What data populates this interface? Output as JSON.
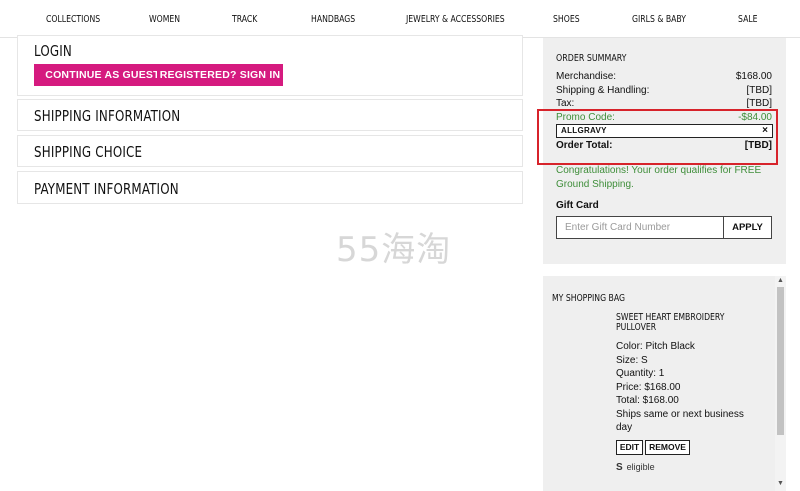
{
  "nav": {
    "items": [
      "COLLECTIONS",
      "WOMEN",
      "TRACK",
      "HANDBAGS",
      "JEWELRY & ACCESSORIES",
      "SHOES",
      "GIRLS & BABY",
      "SALE"
    ]
  },
  "checkout": {
    "login": {
      "title": "LOGIN",
      "guest_button": "CONTINUE AS GUEST",
      "signin_button": "REGISTERED? SIGN IN"
    },
    "shipping_info": "SHIPPING INFORMATION",
    "shipping_choice": "SHIPPING CHOICE",
    "payment_info": "PAYMENT INFORMATION"
  },
  "summary": {
    "title": "ORDER SUMMARY",
    "merchandise_label": "Merchandise:",
    "merchandise_value": "$168.00",
    "shipping_label": "Shipping & Handling:",
    "shipping_value": "[TBD]",
    "tax_label": "Tax:",
    "tax_value": "[TBD]",
    "promo_label": "Promo Code:",
    "promo_value": "-$84.00",
    "promo_code": "ALLGRAVY",
    "remove_glyph": "×",
    "total_label": "Order Total:",
    "total_value": "[TBD]",
    "congrats": "Congratulations! Your order qualifies for FREE Ground Shipping.",
    "gift_label": "Gift Card",
    "gift_placeholder": "Enter Gift Card Number",
    "apply_label": "APPLY"
  },
  "watermark": "55海淘",
  "bag": {
    "title": "MY SHOPPING BAG",
    "item": {
      "name": "SWEET HEART EMBROIDERY PULLOVER",
      "color": "Color: Pitch Black",
      "size": "Size: S",
      "quantity": "Quantity: 1",
      "price": "Price: $168.00",
      "total": "Total: $168.00",
      "ships_line1": "Ships same or next business",
      "ships_line2": "day",
      "edit_label": "EDIT",
      "remove_label": "REMOVE",
      "eligible_icon": "S",
      "eligible_label": "eligible"
    }
  },
  "colors": {
    "accent_pink": "#d51a7f",
    "promo_green": "#3f8e3a",
    "highlight_red": "#d7232b"
  }
}
